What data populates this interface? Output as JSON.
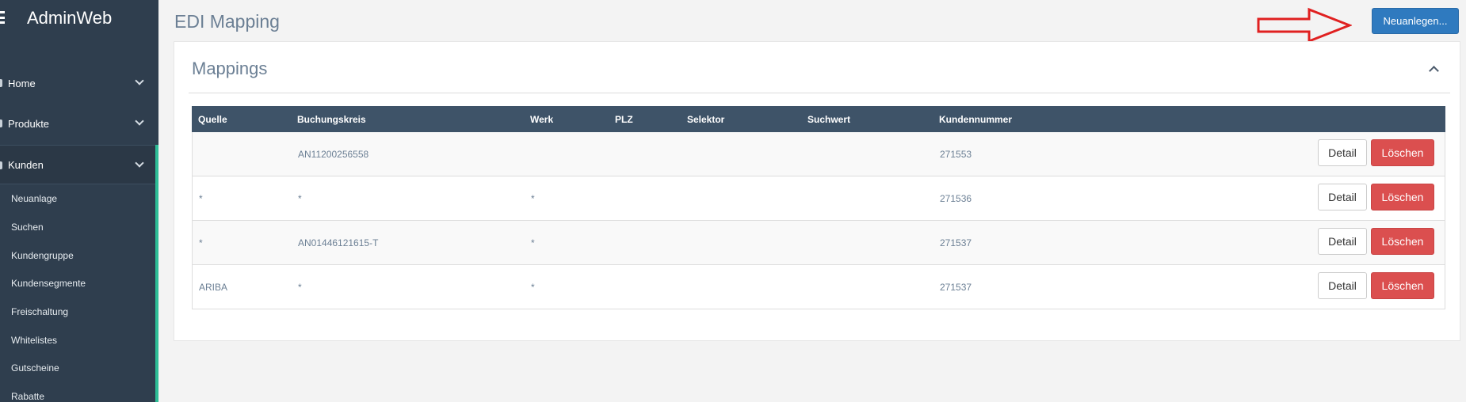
{
  "app": {
    "brand": "AdminWeb"
  },
  "sidebar": {
    "items": [
      {
        "label": "Home"
      },
      {
        "label": "Produkte"
      },
      {
        "label": "Kunden"
      }
    ],
    "sub_items": [
      {
        "label": "Neuanlage"
      },
      {
        "label": "Suchen"
      },
      {
        "label": "Kundengruppe"
      },
      {
        "label": "Kundensegmente"
      },
      {
        "label": "Freischaltung"
      },
      {
        "label": "Whitelistes"
      },
      {
        "label": "Gutscheine"
      },
      {
        "label": "Rabatte"
      }
    ]
  },
  "header": {
    "title": "EDI Mapping",
    "new_button": "Neuanlegen..."
  },
  "panel": {
    "title": "Mappings"
  },
  "table": {
    "columns": {
      "quelle": "Quelle",
      "buchungskreis": "Buchungskreis",
      "werk": "Werk",
      "plz": "PLZ",
      "selektor": "Selektor",
      "suchwert": "Suchwert",
      "kundennummer": "Kundennummer"
    },
    "rows": [
      {
        "quelle": "",
        "buchungskreis": "AN11200256558",
        "werk": "",
        "plz": "",
        "selektor": "",
        "suchwert": "",
        "kundennummer": "271553"
      },
      {
        "quelle": "*",
        "buchungskreis": "*",
        "werk": "*",
        "plz": "",
        "selektor": "",
        "suchwert": "",
        "kundennummer": "271536"
      },
      {
        "quelle": "*",
        "buchungskreis": "AN01446121615-T",
        "werk": "*",
        "plz": "",
        "selektor": "",
        "suchwert": "",
        "kundennummer": "271537"
      },
      {
        "quelle": "ARIBA",
        "buchungskreis": "*",
        "werk": "*",
        "plz": "",
        "selektor": "",
        "suchwert": "",
        "kundennummer": "271537"
      }
    ],
    "detail_label": "Detail",
    "delete_label": "Löschen"
  },
  "colors": {
    "sidebar_bg": "#2f3e4e",
    "accent_green": "#2dbd96",
    "primary_blue": "#2f7abf",
    "danger_red": "#db4f4f",
    "annotation_arrow": "#e02020"
  }
}
